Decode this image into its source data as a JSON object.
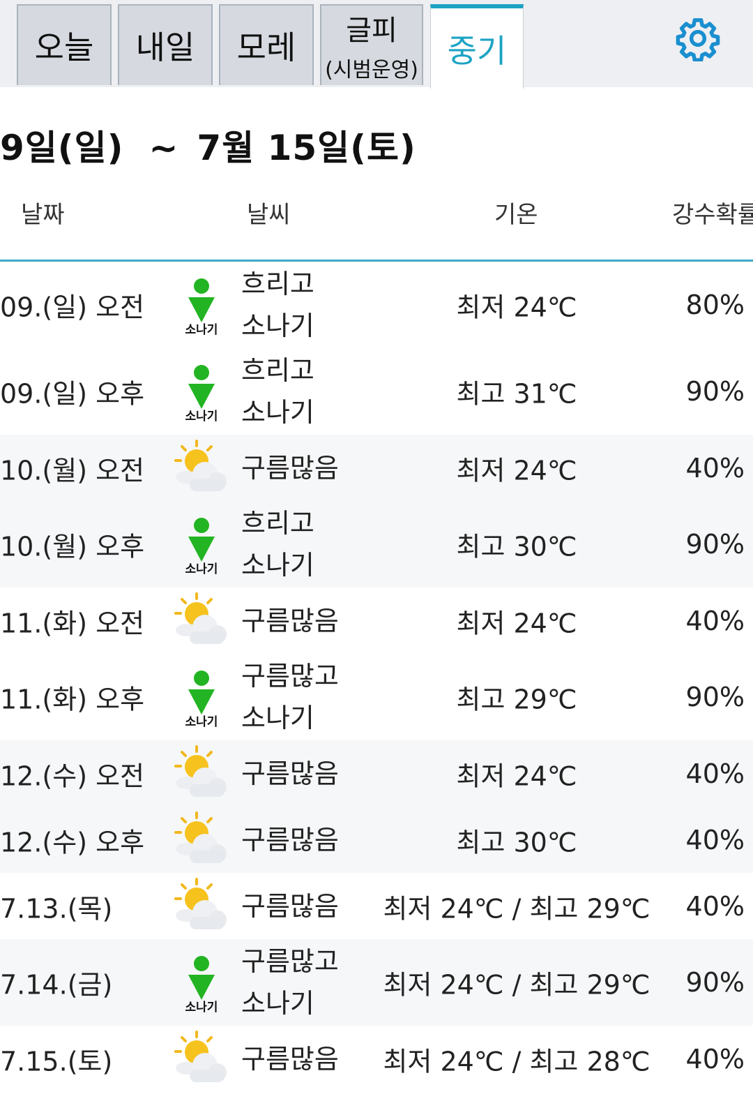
{
  "tabs": [
    {
      "label": "오늘"
    },
    {
      "label": "내일"
    },
    {
      "label": "모레"
    },
    {
      "label": "글피",
      "sub": "(시범운영)"
    },
    {
      "label": "중기"
    }
  ],
  "active_tab": "중기",
  "settings_icon": "gear-icon",
  "accent_color": "#1ca3c4",
  "period": {
    "start": "9일(일)",
    "separator": "~",
    "end": "7월 15일(토)"
  },
  "table": {
    "headers": {
      "date": "날짜",
      "weather": "날씨",
      "temp": "기온",
      "pop": "강수확률"
    },
    "rows": [
      {
        "date": "09.(일) 오전",
        "icon": "shower-icon",
        "weather": [
          "흐리고",
          "소나기"
        ],
        "temp": "최저 24℃",
        "pop": "80%"
      },
      {
        "date": "09.(일) 오후",
        "icon": "shower-icon",
        "weather": [
          "흐리고",
          "소나기"
        ],
        "temp": "최고 31℃",
        "pop": "90%"
      },
      {
        "date": "10.(월) 오전",
        "icon": "partly-cloudy-icon",
        "weather": [
          "구름많음"
        ],
        "temp": "최저 24℃",
        "pop": "40%"
      },
      {
        "date": "10.(월) 오후",
        "icon": "shower-icon",
        "weather": [
          "흐리고",
          "소나기"
        ],
        "temp": "최고 30℃",
        "pop": "90%"
      },
      {
        "date": "11.(화) 오전",
        "icon": "partly-cloudy-icon",
        "weather": [
          "구름많음"
        ],
        "temp": "최저 24℃",
        "pop": "40%"
      },
      {
        "date": "11.(화) 오후",
        "icon": "shower-icon",
        "weather": [
          "구름많고",
          "소나기"
        ],
        "temp": "최고 29℃",
        "pop": "90%"
      },
      {
        "date": "12.(수) 오전",
        "icon": "partly-cloudy-icon",
        "weather": [
          "구름많음"
        ],
        "temp": "최저 24℃",
        "pop": "40%"
      },
      {
        "date": "12.(수) 오후",
        "icon": "partly-cloudy-icon",
        "weather": [
          "구름많음"
        ],
        "temp": "최고 30℃",
        "pop": "40%"
      },
      {
        "date": "7.13.(목)",
        "icon": "partly-cloudy-icon",
        "weather": [
          "구름많음"
        ],
        "temp": "최저 24℃ / 최고 29℃",
        "pop": "40%"
      },
      {
        "date": "7.14.(금)",
        "icon": "shower-icon",
        "weather": [
          "구름많고",
          "소나기"
        ],
        "temp": "최저 24℃ / 최고 29℃",
        "pop": "90%"
      },
      {
        "date": "7.15.(토)",
        "icon": "partly-cloudy-icon",
        "weather": [
          "구름많음"
        ],
        "temp": "최저 24℃ / 최고 28℃",
        "pop": "40%"
      }
    ],
    "shower_icon_label": "소나기"
  }
}
